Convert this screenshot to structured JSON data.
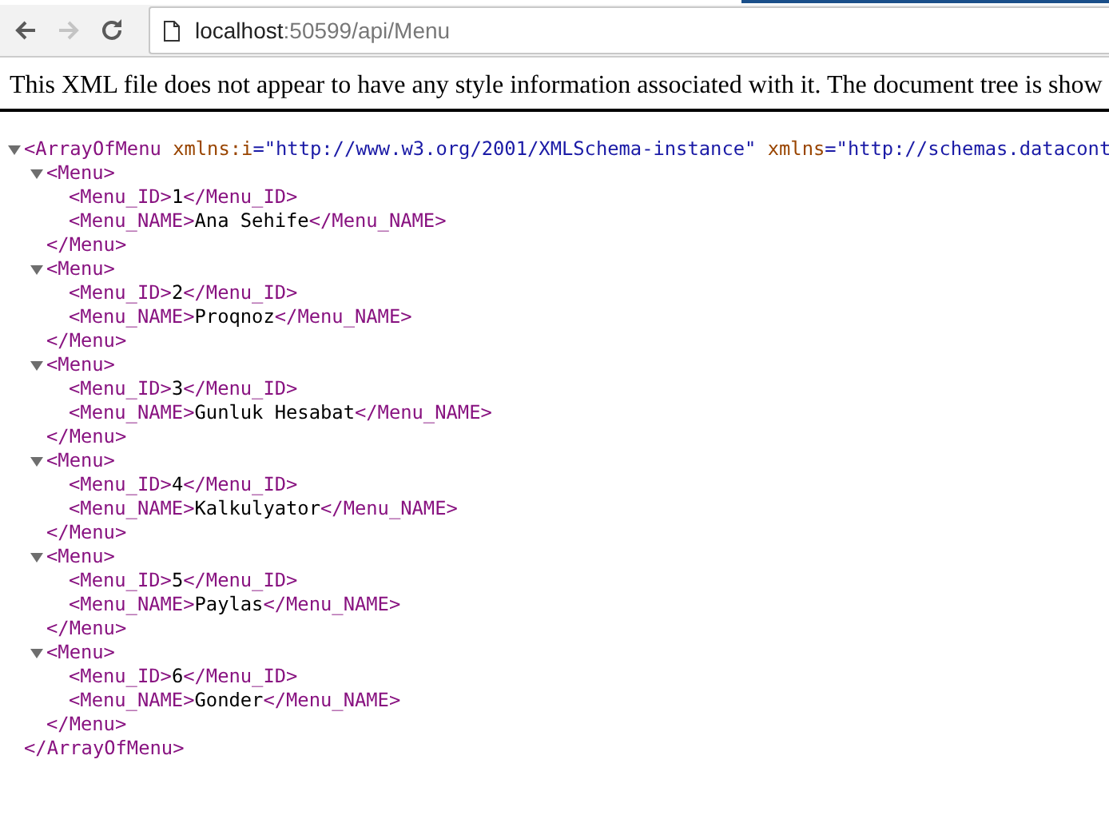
{
  "toolbar": {
    "back": {
      "disabled": false
    },
    "forward": {
      "disabled": true
    },
    "address": {
      "host": "localhost",
      "path": ":50599/api/Menu"
    }
  },
  "notice": "This XML file does not appear to have any style information associated with it. The document tree is show",
  "tree": {
    "expanded": true,
    "open": [
      {
        "kind": "tag",
        "text": "<ArrayOfMenu"
      },
      {
        "kind": "attr",
        "text": " xmlns:i"
      },
      {
        "kind": "value",
        "text": "=\"http://www.w3.org/2001/XMLSchema-instance\""
      },
      {
        "kind": "attr",
        "text": " xmlns"
      },
      {
        "kind": "value",
        "text": "=\"http://schemas.datacont"
      }
    ],
    "close": [
      {
        "kind": "tag",
        "text": "</ArrayOfMenu>"
      }
    ],
    "children": [
      {
        "expanded": true,
        "open": [
          {
            "kind": "tag",
            "text": "<Menu>"
          }
        ],
        "close": [
          {
            "kind": "tag",
            "text": "</Menu>"
          }
        ],
        "children": [
          {
            "line": [
              {
                "kind": "tag",
                "text": "<Menu_ID>"
              },
              {
                "kind": "text",
                "text": "1"
              },
              {
                "kind": "tag",
                "text": "</Menu_ID>"
              }
            ]
          },
          {
            "line": [
              {
                "kind": "tag",
                "text": "<Menu_NAME>"
              },
              {
                "kind": "text",
                "text": "Ana Sehife"
              },
              {
                "kind": "tag",
                "text": "</Menu_NAME>"
              }
            ]
          }
        ]
      },
      {
        "expanded": true,
        "open": [
          {
            "kind": "tag",
            "text": "<Menu>"
          }
        ],
        "close": [
          {
            "kind": "tag",
            "text": "</Menu>"
          }
        ],
        "children": [
          {
            "line": [
              {
                "kind": "tag",
                "text": "<Menu_ID>"
              },
              {
                "kind": "text",
                "text": "2"
              },
              {
                "kind": "tag",
                "text": "</Menu_ID>"
              }
            ]
          },
          {
            "line": [
              {
                "kind": "tag",
                "text": "<Menu_NAME>"
              },
              {
                "kind": "text",
                "text": "Proqnoz"
              },
              {
                "kind": "tag",
                "text": "</Menu_NAME>"
              }
            ]
          }
        ]
      },
      {
        "expanded": true,
        "open": [
          {
            "kind": "tag",
            "text": "<Menu>"
          }
        ],
        "close": [
          {
            "kind": "tag",
            "text": "</Menu>"
          }
        ],
        "children": [
          {
            "line": [
              {
                "kind": "tag",
                "text": "<Menu_ID>"
              },
              {
                "kind": "text",
                "text": "3"
              },
              {
                "kind": "tag",
                "text": "</Menu_ID>"
              }
            ]
          },
          {
            "line": [
              {
                "kind": "tag",
                "text": "<Menu_NAME>"
              },
              {
                "kind": "text",
                "text": "Gunluk Hesabat"
              },
              {
                "kind": "tag",
                "text": "</Menu_NAME>"
              }
            ]
          }
        ]
      },
      {
        "expanded": true,
        "open": [
          {
            "kind": "tag",
            "text": "<Menu>"
          }
        ],
        "close": [
          {
            "kind": "tag",
            "text": "</Menu>"
          }
        ],
        "children": [
          {
            "line": [
              {
                "kind": "tag",
                "text": "<Menu_ID>"
              },
              {
                "kind": "text",
                "text": "4"
              },
              {
                "kind": "tag",
                "text": "</Menu_ID>"
              }
            ]
          },
          {
            "line": [
              {
                "kind": "tag",
                "text": "<Menu_NAME>"
              },
              {
                "kind": "text",
                "text": "Kalkulyator"
              },
              {
                "kind": "tag",
                "text": "</Menu_NAME>"
              }
            ]
          }
        ]
      },
      {
        "expanded": true,
        "open": [
          {
            "kind": "tag",
            "text": "<Menu>"
          }
        ],
        "close": [
          {
            "kind": "tag",
            "text": "</Menu>"
          }
        ],
        "children": [
          {
            "line": [
              {
                "kind": "tag",
                "text": "<Menu_ID>"
              },
              {
                "kind": "text",
                "text": "5"
              },
              {
                "kind": "tag",
                "text": "</Menu_ID>"
              }
            ]
          },
          {
            "line": [
              {
                "kind": "tag",
                "text": "<Menu_NAME>"
              },
              {
                "kind": "text",
                "text": "Paylas"
              },
              {
                "kind": "tag",
                "text": "</Menu_NAME>"
              }
            ]
          }
        ]
      },
      {
        "expanded": true,
        "open": [
          {
            "kind": "tag",
            "text": "<Menu>"
          }
        ],
        "close": [
          {
            "kind": "tag",
            "text": "</Menu>"
          }
        ],
        "children": [
          {
            "line": [
              {
                "kind": "tag",
                "text": "<Menu_ID>"
              },
              {
                "kind": "text",
                "text": "6"
              },
              {
                "kind": "tag",
                "text": "</Menu_ID>"
              }
            ]
          },
          {
            "line": [
              {
                "kind": "tag",
                "text": "<Menu_NAME>"
              },
              {
                "kind": "text",
                "text": "Gonder"
              },
              {
                "kind": "tag",
                "text": "</Menu_NAME>"
              }
            ]
          }
        ]
      }
    ]
  }
}
